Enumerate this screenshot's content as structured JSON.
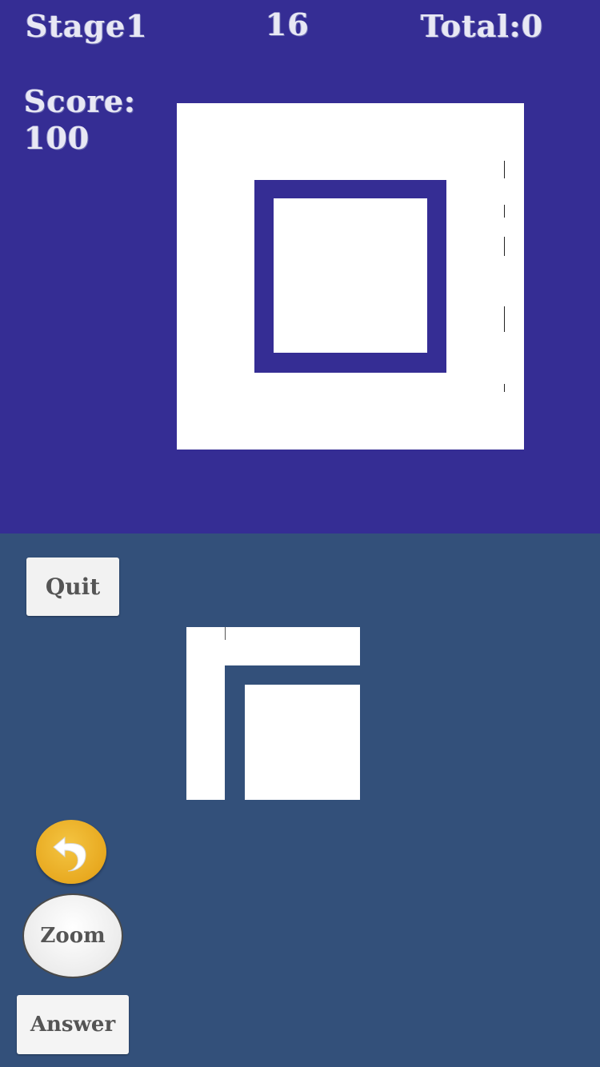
{
  "hud": {
    "stage": "Stage1",
    "timer": "16",
    "total": "Total:0",
    "score_label": "Score:",
    "score_value": "100"
  },
  "buttons": {
    "quit": "Quit",
    "zoom": "Zoom",
    "answer": "Answer"
  },
  "icons": {
    "undo": "undo-arrow-icon"
  },
  "colors": {
    "top_background": "#352d94",
    "bottom_background": "#33507a",
    "board": "#ffffff",
    "piece": "#ffffff",
    "frame": "#352d94",
    "undo_button": "#eeb02c"
  }
}
